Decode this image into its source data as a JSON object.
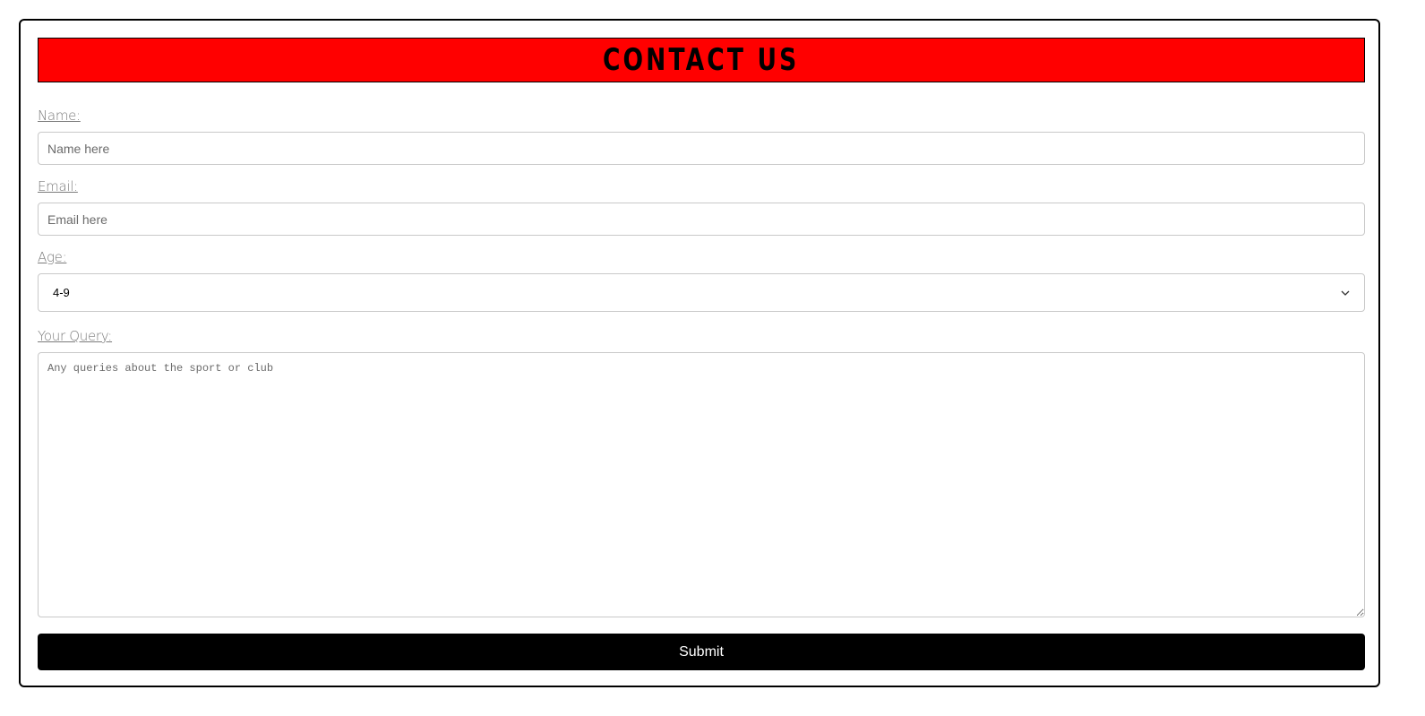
{
  "form": {
    "title": "CONTACT US",
    "name_label": "Name:",
    "name_placeholder": "Name here",
    "email_label": "Email:",
    "email_placeholder": "Email here",
    "age_label": "Age:",
    "age_selected": "4-9",
    "query_label": "Your Query:",
    "query_placeholder": "Any queries about the sport or club",
    "submit_label": "Submit"
  },
  "icons": {
    "select_arrow": "chevron-down-icon",
    "textarea_resize": "resize-handle-icon"
  },
  "colors": {
    "banner": "#ff0000",
    "submit_bg": "#000000",
    "submit_text": "#ffffff",
    "label": "#7a7a7a"
  }
}
